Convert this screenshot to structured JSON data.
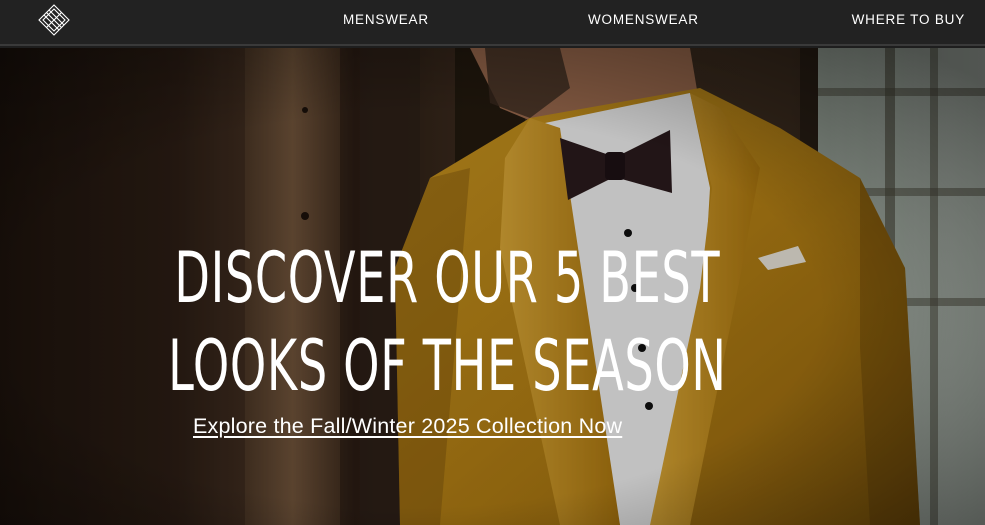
{
  "nav": {
    "logo_icon": "diamond-lattice-logo-icon",
    "links": [
      {
        "label": "MENSWEAR"
      },
      {
        "label": "WOMENSWEAR"
      },
      {
        "label": "WHERE TO BUY"
      }
    ]
  },
  "hero": {
    "headline_line1": "DISCOVER OUR 5 BEST",
    "headline_line2": "LOOKS OF THE SEASON",
    "cta_label": "Explore the Fall/Winter 2025 Collection Now"
  },
  "colors": {
    "nav_bg": "#222222",
    "jacket": "#b8861c",
    "text": "#ffffff"
  }
}
